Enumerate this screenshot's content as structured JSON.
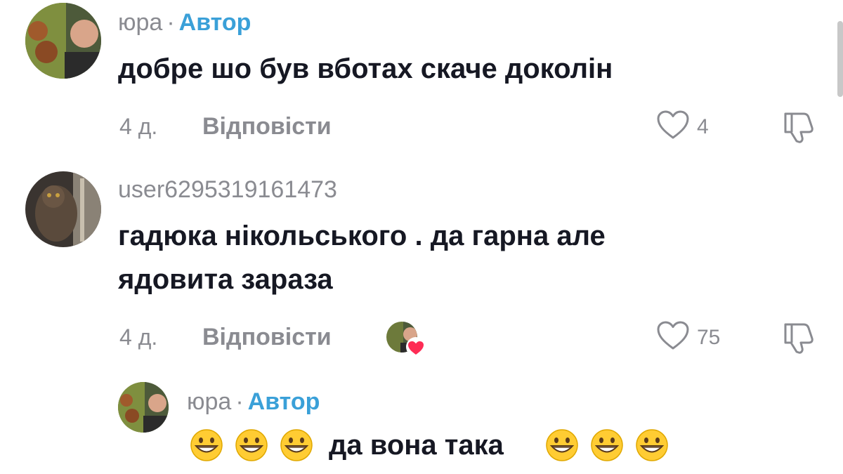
{
  "comments": [
    {
      "username": "юра",
      "separator": "·",
      "author_badge": "Автор",
      "text": "добре шо був вботах скаче доколін",
      "age": "4 д.",
      "reply_label": "Відповісти",
      "likes": "4",
      "avatar_icon": "user-photo-man"
    },
    {
      "username": "user6295319161473",
      "text_line1": "гадюка нікольського . да гарна але",
      "text_line2": "ядовита зараза",
      "age": "4 д.",
      "reply_label": "Відповісти",
      "likes": "75",
      "avatar_icon": "user-photo-cat",
      "creator_liked_icon": "creator-liked-heart-icon"
    }
  ],
  "reply": {
    "username": "юра",
    "separator": "·",
    "author_badge": "Автор",
    "text": "да вона така",
    "emoji_icon": "grinning-face-emoji"
  },
  "colors": {
    "text": "#161823",
    "muted": "#8a8b91",
    "author": "#3aa0d8",
    "heart_red": "#fe2c55"
  }
}
